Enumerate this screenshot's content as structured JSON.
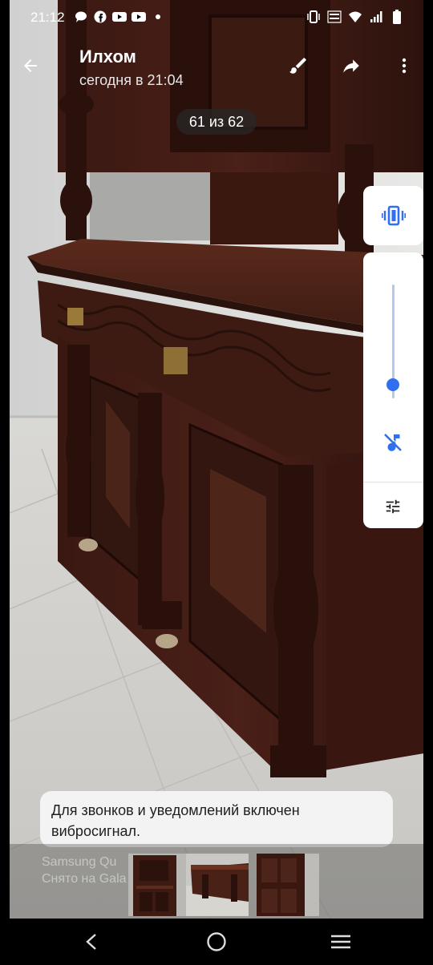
{
  "status": {
    "time": "21:12",
    "left_icons": [
      "bubble-icon",
      "facebook-icon",
      "youtube-icon",
      "youtube-icon",
      "dot-icon"
    ],
    "right_icons": [
      "vibrate-icon",
      "volte-icon",
      "wifi-icon",
      "signal-icon",
      "battery-icon"
    ]
  },
  "header": {
    "sender": "Илхом",
    "timestamp": "сегодня в 21:04",
    "counter": "61 из 62",
    "actions": [
      "edit-brush-icon",
      "share-forward-icon",
      "more-vert-icon"
    ]
  },
  "volume_panel": {
    "ringer_mode_icon": "vibrate-icon",
    "level": 0.12,
    "mute_icon": "music-muted-icon",
    "settings_icon": "tune-icon",
    "accent": "#2f6ff0"
  },
  "toast": {
    "text": "Для звонков и уведомлений включен вибросигнал."
  },
  "gallery": {
    "watermark_line1": "Samsung Qu",
    "watermark_line2": "Снято на Gala",
    "thumbnails": [
      "thumbnail-1",
      "thumbnail-2",
      "thumbnail-3"
    ]
  },
  "nav": {
    "buttons": [
      "back-nav-icon",
      "home-nav-icon",
      "recents-nav-icon"
    ]
  }
}
